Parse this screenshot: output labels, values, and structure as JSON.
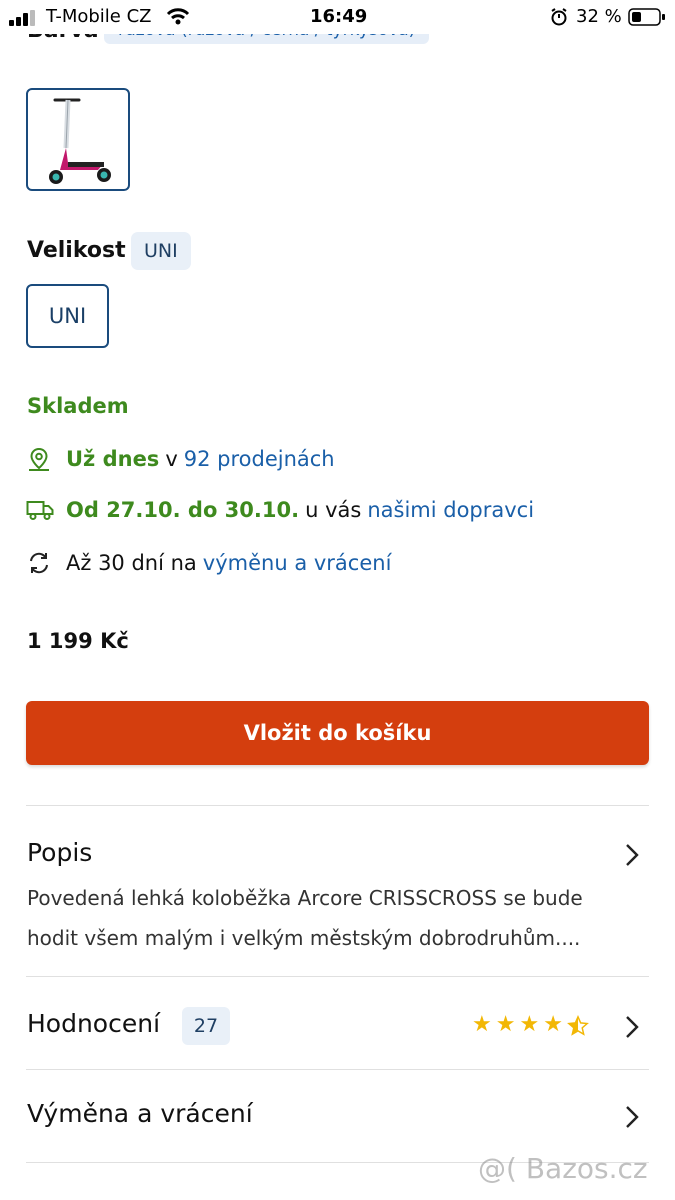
{
  "status_bar": {
    "carrier": "T-Mobile CZ",
    "time": "16:49",
    "battery": "32 %"
  },
  "color_section": {
    "label": "Barva",
    "value": "růžová (růžová / černá / tyrkysová)"
  },
  "size_section": {
    "label": "Velikost",
    "selected": "UNI",
    "option": "UNI"
  },
  "availability": {
    "stock": "Skladem",
    "store": {
      "bold": "Už dnes",
      "middle": "v",
      "link": "92 prodejnách"
    },
    "delivery": {
      "bold": "Od 27.10. do 30.10.",
      "middle": "u vás",
      "link": "našimi dopravci"
    },
    "returns": {
      "text": "Až 30 dní na",
      "link": "výměnu a vrácení"
    }
  },
  "price": "1 199 Kč",
  "cta_label": "Vložit do košíku",
  "description": {
    "title": "Popis",
    "text": "Povedená lehká koloběžka Arcore CRISSCROSS se bude hodit všem malým i velkým městským dobrodruhům...."
  },
  "rating": {
    "title": "Hodnocení",
    "count": "27",
    "stars": 4.5
  },
  "exchange": {
    "title": "Výměna a vrácení"
  },
  "watermark": "@( Bazos.cz",
  "colors": {
    "accent": "#d43e0e",
    "green": "#3e8a1e",
    "link": "#1a5fa8",
    "star": "#f2b705"
  }
}
